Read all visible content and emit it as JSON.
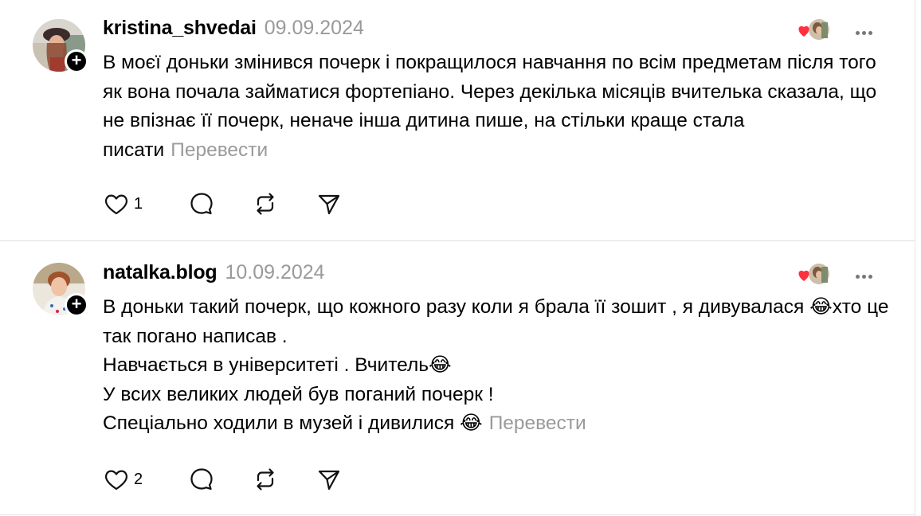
{
  "posts": [
    {
      "username": "kristina_shvedai",
      "date": "09.09.2024",
      "text": "В моєї доньки змінився почерк і покращилося навчання по всім предметам після того як вона почала займатися фортепіано. Через декілька місяців вчителька сказала, що не впізнає її почерк, неначе інша дитина пише, на стільки краще стала писати",
      "translate_label": "Перевести",
      "like_count": "1"
    },
    {
      "username": "natalka.blog",
      "date": "10.09.2024",
      "text": "В доньки такий почерк, що кожного разу коли я брала її зошит , я дивувалася 😂хто це так погано написав .\nНавчається в університеті . Вчитель😂\nУ всих великих людей був поганий почерк !\nСпеціально ходили в музей і дивилися 😂",
      "translate_label": "Перевести",
      "like_count": "2"
    }
  ],
  "icons": {
    "follow": "+",
    "heart_color": "#ff3040"
  }
}
